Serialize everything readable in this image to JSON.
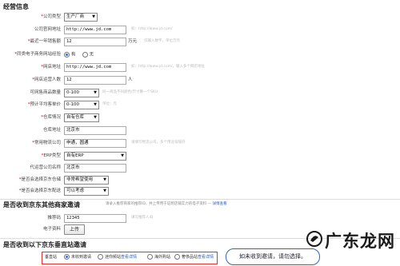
{
  "section1": {
    "title": "经营信息"
  },
  "fields": {
    "company_type": {
      "label": "公司类型",
      "value": "生产厂商"
    },
    "company_site": {
      "label": "公司官网地址",
      "value": "http://www.jd.com",
      "hint": "如：http://www.jd.com/"
    },
    "annual_sales": {
      "label": "最近一年销售额",
      "value": "12",
      "unit": "万元",
      "hint": "仅输入数字，单位万元"
    },
    "has_online_shop": {
      "label": "同类电子商务网站经验",
      "opt_yes": "有",
      "opt_no": "无"
    },
    "shop_url": {
      "label": "网店地址",
      "value": "http://www.jd.com",
      "hint": "如：http://www.jd.com/，输入多个网店地址"
    },
    "shop_staff": {
      "label": "网店运营人数",
      "value": "12",
      "unit": "人"
    },
    "sku_count": {
      "label": "可网售商品数量",
      "value": "0-100",
      "hint": "同一商品不同颜色/尺寸算一个SKU"
    },
    "avg_price": {
      "label": "预计平均客单价",
      "value": "0-100",
      "hint": "单位：元"
    },
    "warehouse": {
      "label": "仓库情况",
      "value": "自有仓库"
    },
    "warehouse_addr": {
      "label": "仓库地址",
      "value": "北京市"
    },
    "carrier": {
      "label": "常用物流公司",
      "value": "申通，圆通",
      "hint": "请填写物流公司，多个用逗号隔开"
    },
    "erp": {
      "label": "ERP类型",
      "value": "自有ERP"
    },
    "agency_name": {
      "label": "代运营公司名称",
      "value": "北京市"
    },
    "jd_warehouse": {
      "label": "是否会选择京东仓储",
      "value": "非常希望使用"
    },
    "jd_delivery": {
      "label": "是否会选择京东配送",
      "value": "可以考虑"
    }
  },
  "section2": {
    "title": "是否收到京东其他商家邀请",
    "note": "请录入推荐商家的推荐ID，并上传用于证明店铺实力的电子资料 —",
    "note_link": "详情查看",
    "ref_code": {
      "label": "推荐码",
      "value": "12345",
      "hint": "填写推荐人ID"
    },
    "upload": {
      "label": "电子资料",
      "button": "上传"
    }
  },
  "section3": {
    "title": "是否收到以下京东垂直站邀请",
    "label": "垂直站",
    "options": [
      {
        "text": "未收到邀请",
        "selected": true,
        "link": ""
      },
      {
        "text": "迷你频站",
        "selected": false,
        "link": "查看详情"
      },
      {
        "text": "海外购站",
        "selected": false,
        "link": ""
      },
      {
        "text": "奢侈品站",
        "selected": false,
        "link": "查看详情"
      }
    ]
  },
  "callout": {
    "text": "如未收到邀请，请勿选择。"
  },
  "watermark": {
    "text": "广东龙网"
  },
  "colors": {
    "accent": "#3a6fd8",
    "highlight_border": "#dd3333",
    "callout_border": "#3366bb"
  }
}
